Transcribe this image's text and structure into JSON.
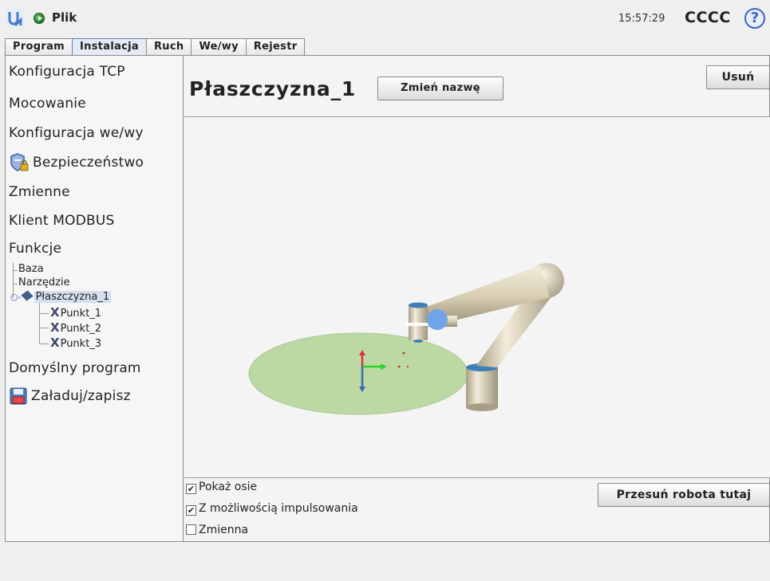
{
  "topbar": {
    "file_menu": "Plik",
    "clock": "15:57:29",
    "robot_name": "CCCC",
    "help": "?"
  },
  "tabs": [
    "Program",
    "Instalacja",
    "Ruch",
    "We/wy",
    "Rejestr"
  ],
  "active_tab": "Instalacja",
  "sidebar": {
    "items": [
      {
        "label": "Konfiguracja TCP"
      },
      {
        "label": "Mocowanie"
      },
      {
        "label": "Konfiguracja we/wy"
      },
      {
        "label": "Bezpieczeństwo",
        "icon": "safety-shield-lock-icon"
      },
      {
        "label": "Zmienne"
      },
      {
        "label": "Klient MODBUS"
      },
      {
        "label": "Funkcje"
      },
      {
        "label": "Domyślny program"
      },
      {
        "label": "Załaduj/zapisz",
        "icon": "floppy-disk-icon"
      }
    ],
    "tree": {
      "baza": "Baza",
      "narzedzie": "Narzędzie",
      "plane": "Płaszczyzna_1",
      "points": [
        "Punkt_1",
        "Punkt_2",
        "Punkt_3"
      ]
    }
  },
  "main": {
    "title": "Płaszczyzna_1",
    "rename_button": "Zmień nazwę",
    "delete_button": "Usuń",
    "options": [
      {
        "label": "Pokaż osie",
        "checked": true
      },
      {
        "label": "Z możliwością impulsowania",
        "checked": true
      },
      {
        "label": "Zmienna",
        "checked": false
      }
    ],
    "move_button": "Przesuń robota tutaj"
  },
  "colors": {
    "plane": "#bcd9a4",
    "robot_body": "#d8cfb4",
    "robot_joint": "#3d7fb8",
    "tcp": "#6fa5e8",
    "accent": "#3a66c4"
  }
}
